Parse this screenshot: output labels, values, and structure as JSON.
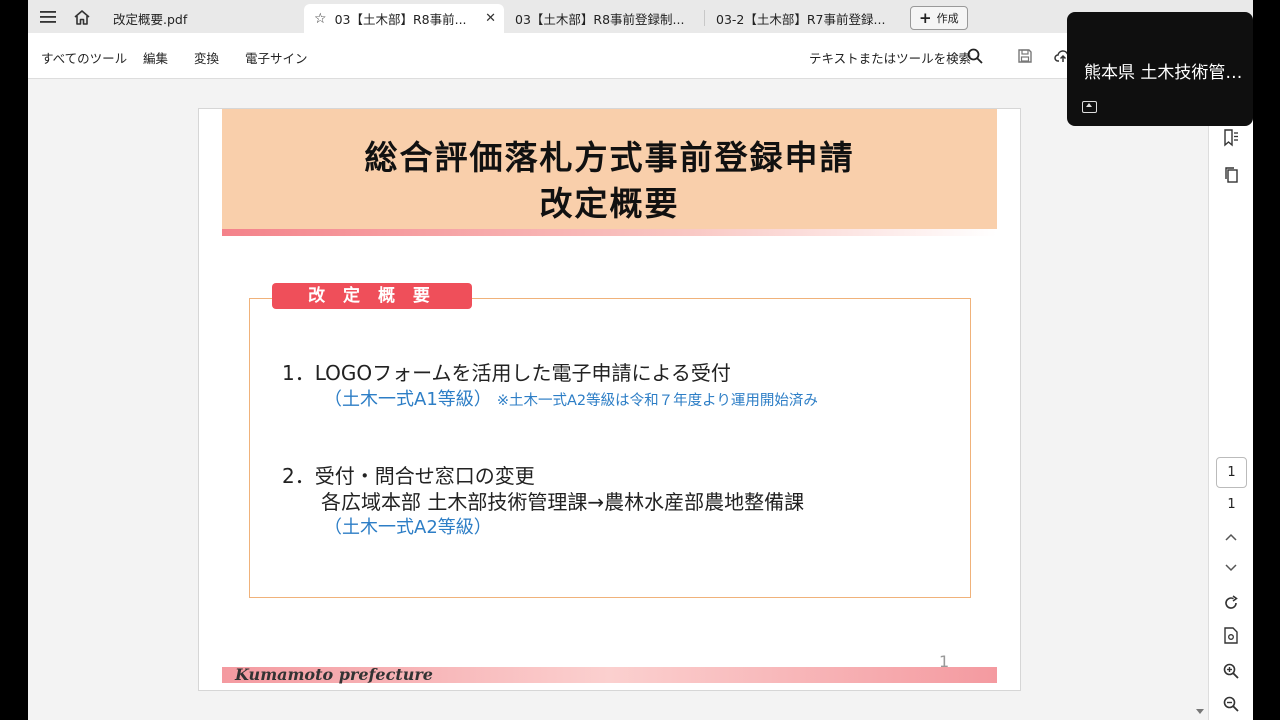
{
  "tabs": [
    {
      "label": "改定概要.pdf"
    },
    {
      "label": "03【土木部】R8事前..."
    },
    {
      "label": "03【土木部】R8事前登録制..."
    },
    {
      "label": "03-2【土木部】R7事前登録..."
    }
  ],
  "create_button": {
    "label": "作成"
  },
  "toolbar": {
    "menu": [
      "すべてのツール",
      "編集",
      "変換",
      "電子サイン"
    ],
    "search_label": "テキストまたはツールを検索"
  },
  "document": {
    "title_line1": "総合評価落札方式事前登録申請",
    "title_line2": "改定概要",
    "section_label": "改 定 概 要",
    "item1_heading": "1．LOGOフォームを活用した電子申請による受付",
    "item1_sub": "（土木一式A1等級）",
    "item1_note": "※土木一式A2等級は令和７年度より運用開始済み",
    "item2_heading": "2．受付・問合せ窓口の変更",
    "item2_detail": "各広域本部 土木部技術管理課→農林水産部農地整備課",
    "item2_sub": "（土木一式A2等級）",
    "footer": "Kumamoto prefecture",
    "page_number": "1"
  },
  "page_nav": {
    "current": "1",
    "total": "1"
  },
  "notification": {
    "title": "熊本県 土木技術管理課"
  },
  "colors": {
    "banner": "#f9cfab",
    "section_tab": "#ef4f5a",
    "box_border": "#f0b27a",
    "accent_text": "#2d7ec6"
  }
}
